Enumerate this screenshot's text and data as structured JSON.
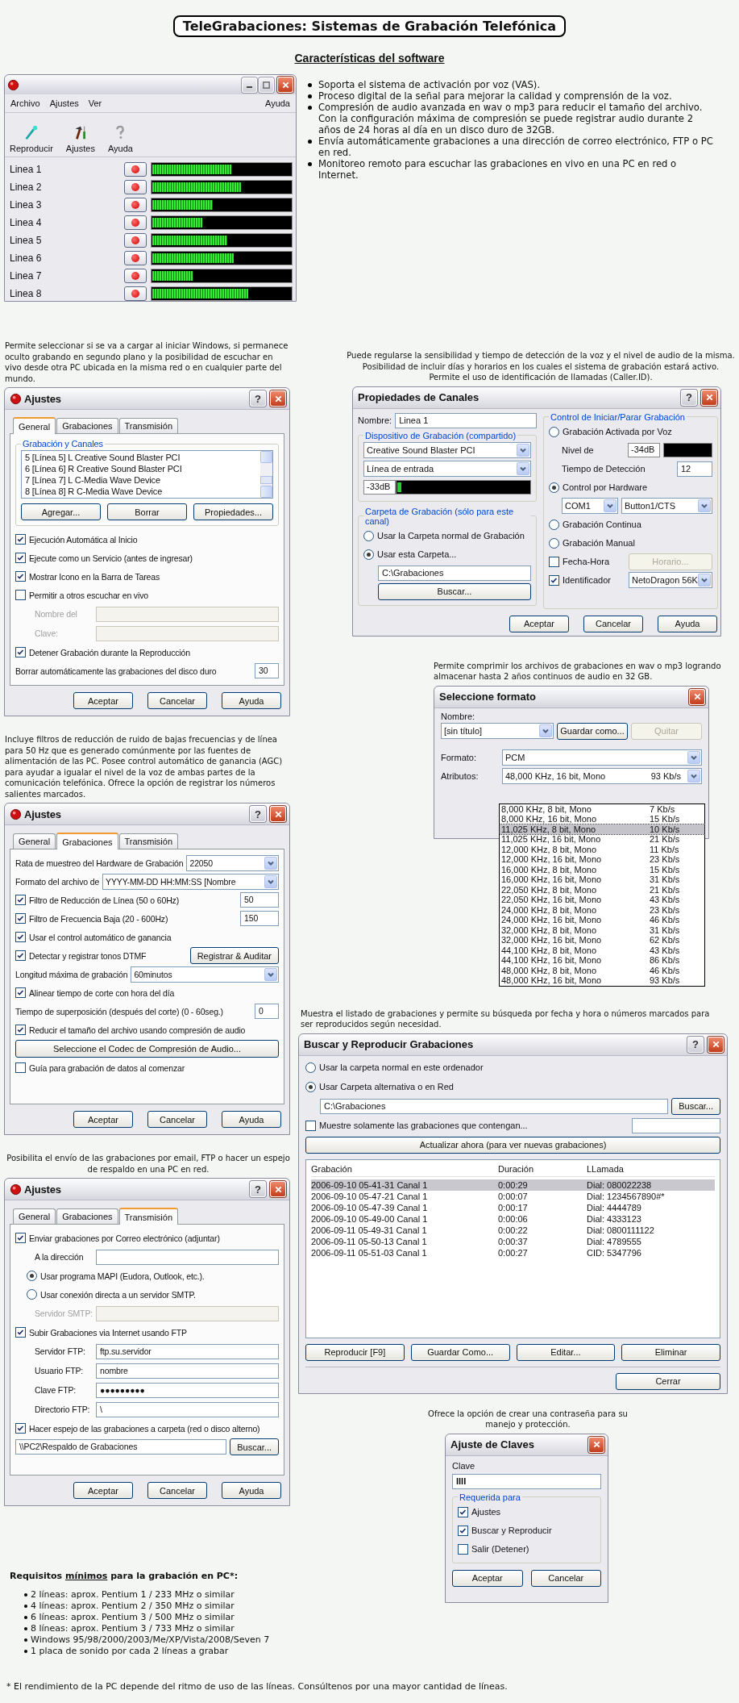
{
  "title": "TeleGrabaciones: Sistemas de Grabación Telefónica",
  "subtitle": "Características del software",
  "main_window": {
    "menu": [
      "Archivo",
      "Ajustes",
      "Ver",
      "Ayuda"
    ],
    "toolbar": [
      {
        "label": "Reproducir",
        "kind": "play"
      },
      {
        "label": "Ajustes",
        "kind": "tools"
      },
      {
        "label": "Ayuda",
        "kind": "help"
      }
    ],
    "lines": [
      {
        "name": "Linea 1",
        "level": 0.57
      },
      {
        "name": "Linea 2",
        "level": 0.64
      },
      {
        "name": "Linea 3",
        "level": 0.44
      },
      {
        "name": "Linea 4",
        "level": 0.36
      },
      {
        "name": "Linea 5",
        "level": 0.54
      },
      {
        "name": "Linea 6",
        "level": 0.59
      },
      {
        "name": "Linea 7",
        "level": 0.29
      },
      {
        "name": "Linea 8",
        "level": 0.69
      }
    ]
  },
  "features": [
    "Soporta el sistema de activación por voz (VAS).",
    "Proceso digital de la señal para mejorar la calidad y comprensión de la voz.",
    "Compresión de audio avanzada en wav o mp3 para reducir el tamaño del archivo. Con la configuración máxima de compresión se puede registrar audio durante 2 años de 24 horas al día en un disco duro de 32GB.",
    "Envía automáticamente grabaciones a una dirección de correo electrónico, FTP o PC en red.",
    "Monitoreo remoto para escuchar las grabaciones en vivo en una PC en red o Internet."
  ],
  "settings_windows": [
    {
      "caption": "Permite seleccionar si se va a cargar al iniciar Windows, si permanece oculto grabando en segundo plano y la posibilidad de escuchar en vivo desde otra PC ubicada en la misma red o en cualquier parte del mundo.",
      "title": "Ajustes",
      "help_button": "?",
      "tabs": [
        {
          "label": "General",
          "selected": true
        },
        {
          "label": "Grabaciones",
          "selected": false
        },
        {
          "label": "Transmisión",
          "selected": false
        }
      ],
      "group": {
        "label": "Grabación y Canales",
        "items": [
          "5 [Línea 5] L Creative Sound Blaster PCI",
          "6 [Línea 6] R Creative Sound Blaster PCI",
          "7 [Línea 7] L C-Media Wave Device",
          "8 [Línea 8] R C-Media Wave Device"
        ],
        "buttons": [
          "Agregar...",
          "Borrar",
          "Propiedades..."
        ]
      },
      "rows": [
        {
          "kind": "check",
          "label": "Ejecución Automática al Inicio",
          "checked": true
        },
        {
          "kind": "check",
          "label": "Ejecute como un Servicio (antes de ingresar)",
          "checked": true
        },
        {
          "kind": "check",
          "label": "Mostrar Icono en la Barra de Tareas",
          "checked": true
        },
        {
          "kind": "check",
          "label": "Permitir a otros escuchar en vivo",
          "checked": false
        },
        {
          "kind": "field",
          "label": "Nombre del",
          "disabled": true
        },
        {
          "kind": "field",
          "label": "Clave:",
          "disabled": true
        },
        {
          "kind": "check",
          "label": "Detener Grabación durante la Reproducción",
          "checked": true
        },
        {
          "kind": "input",
          "label": "Borrar automáticamente las grabaciones del disco duro",
          "value": "30"
        }
      ],
      "buttons": [
        "Aceptar",
        "Cancelar",
        "Ayuda"
      ]
    },
    {
      "caption": "Incluye filtros de reducción de ruido de bajas frecuencias y de línea para 50 Hz que es generado comúnmente por las fuentes de alimentación de las PC. Posee control automático de ganancia (AGC) para ayudar a igualar el nivel de la voz de ambas partes de la comunicación telefónica. Ofrece la opción de registrar los números salientes marcados.",
      "title": "Ajustes",
      "help_button": "?",
      "tabs": [
        {
          "label": "General",
          "selected": false
        },
        {
          "label": "Grabaciones",
          "selected": true
        },
        {
          "label": "Transmisión",
          "selected": false
        }
      ],
      "rows": [
        {
          "kind": "select",
          "label": "Rata de muestreo del Hardware de Grabación",
          "value": "22050"
        },
        {
          "kind": "select",
          "label": "Formato del archivo de",
          "value": "YYYY-MM-DD HH:MM:SS [Nombre"
        },
        {
          "kind": "check-input",
          "label": "Filtro de Reducción de Línea (50 o 60Hz)",
          "checked": true,
          "value": "50"
        },
        {
          "kind": "check-input",
          "label": "Filtro de Frecuencia Baja (20 - 600Hz)",
          "checked": true,
          "value": "150"
        },
        {
          "kind": "check",
          "label": "Usar el control automático de ganancia",
          "checked": true
        },
        {
          "kind": "check-button",
          "label": "Detectar y registrar tonos DTMF",
          "checked": true,
          "button": "Registrar & Auditar"
        },
        {
          "kind": "select",
          "label": "Longitud máxima de grabación",
          "value": "60minutos"
        },
        {
          "kind": "check",
          "label": "Alinear tiempo de corte con hora del día",
          "checked": true
        },
        {
          "kind": "input",
          "label": "Tiempo de superposición (después del corte) (0 - 60seg.)",
          "value": "0"
        },
        {
          "kind": "check",
          "label": "Reducir el tamaño del archivo usando compresión de audio",
          "checked": true
        },
        {
          "kind": "button",
          "label": "Seleccione el Codec de Compresión de Audio..."
        },
        {
          "kind": "check",
          "label": "Guía para grabación de datos al comenzar",
          "checked": false
        }
      ],
      "buttons": [
        "Aceptar",
        "Cancelar",
        "Ayuda"
      ]
    },
    {
      "caption": "Posibilita el envío de las grabaciones por email, FTP o hacer un espejo de respaldo en una PC en red.",
      "title": "Ajustes",
      "help_button": "?",
      "tabs": [
        {
          "label": "General",
          "selected": false
        },
        {
          "label": "Grabaciones",
          "selected": false
        },
        {
          "label": "Transmisión",
          "selected": true
        }
      ],
      "rows": [
        {
          "kind": "check",
          "label": "Enviar grabaciones por Correo electrónico (adjuntar)",
          "checked": true
        },
        {
          "kind": "field",
          "label": "A la dirección",
          "disabled": false
        },
        {
          "kind": "radio",
          "label": "Usar programa MAPI (Eudora, Outlook, etc.).",
          "selected": true
        },
        {
          "kind": "radio",
          "label": "Usar conexión directa a un servidor SMTP.",
          "selected": false
        },
        {
          "kind": "field",
          "label": "Servidor SMTP:",
          "disabled": true
        },
        {
          "kind": "check",
          "label": "Subir Grabaciones via Internet usando FTP",
          "checked": true
        },
        {
          "kind": "field",
          "label": "Servidor FTP:",
          "value": "ftp.su.servidor",
          "disabled": false
        },
        {
          "kind": "field",
          "label": "Usuario FTP:",
          "value": "nombre",
          "disabled": false
        },
        {
          "kind": "field",
          "label": "Clave FTP:",
          "value": "●●●●●●●●●",
          "disabled": false
        },
        {
          "kind": "field",
          "label": "Directorio FTP:",
          "value": "\\",
          "disabled": false
        },
        {
          "kind": "check",
          "label": "Hacer espejo de las grabaciones a carpeta (red o disco alterno)",
          "checked": true
        },
        {
          "kind": "path",
          "value": "\\\\PC2\\Respaldo de Grabaciones",
          "button": "Buscar..."
        }
      ],
      "buttons": [
        "Aceptar",
        "Cancelar",
        "Ayuda"
      ]
    }
  ],
  "channel_properties": {
    "caption": "Puede regularse la sensibilidad y tiempo de detección de la voz y el nivel de audio de la misma. Posibilidad de incluir días y horarios en los cuales el sistema de grabación estará activo. Permite el uso de identificación de llamadas (Caller.ID).",
    "title": "Propiedades de Canales",
    "help_button": "?",
    "name_label": "Nombre:",
    "name": "Linea 1",
    "device": {
      "label": "Dispositivo de Grabación (compartido)",
      "inputs": [
        "Creative Sound Blaster PCI",
        "Línea de entrada"
      ],
      "reading": "-33dB",
      "level": 0.03
    },
    "folder": {
      "label": "Carpeta de Grabación (sólo para este canal)",
      "options": [
        {
          "label": "Usar la Carpeta normal de Grabación",
          "selected": false
        },
        {
          "label": "Usar esta Carpeta...",
          "selected": true
        }
      ],
      "path": "C:\\Grabaciones",
      "button": "Buscar..."
    },
    "control": {
      "label": "Control de Iniciar/Parar Grabación",
      "voice": {
        "label": "Grabación Activada por Voz",
        "selected": false
      },
      "level_label": "Nivel de",
      "reading": "-34dB",
      "time_label": "Tiempo de Detección",
      "time": "12",
      "hardware": {
        "label": "Control por Hardware",
        "selected": true
      },
      "port": "COM1",
      "signal": "Button1/CTS",
      "continuous": {
        "label": "Grabación Continua",
        "selected": false
      },
      "manual": {
        "label": "Grabación Manual",
        "selected": false
      },
      "datetime": {
        "label": "Fecha-Hora",
        "checked": false
      },
      "schedule_button": {
        "label": "Horario...",
        "disabled": true
      },
      "caller_id": {
        "label": "Identificador",
        "checked": true
      },
      "modem": "NetoDragon 56K"
    },
    "buttons": [
      "Aceptar",
      "Cancelar",
      "Ayuda"
    ]
  },
  "format": {
    "caption": "Permite comprimir los archivos de grabaciones en wav o mp3 logrando almacenar hasta 2 años continuos de audio en 32 GB.",
    "title": "Seleccione formato",
    "name_label": "Nombre:",
    "name": "[sin título]",
    "buttons": [
      {
        "label": "Guardar como...",
        "disabled": false
      },
      {
        "label": "Quitar",
        "disabled": true
      }
    ],
    "format_label": "Formato:",
    "format": "PCM",
    "attr_label": "Atributos:",
    "attr": {
      "format": "48,000 KHz, 16 bit, Mono",
      "rate": "93 Kb/s"
    },
    "options": [
      {
        "format": "8,000 KHz, 8 bit, Mono",
        "rate": "7 Kb/s",
        "selected": false
      },
      {
        "format": "8,000 KHz, 16 bit, Mono",
        "rate": "15 Kb/s",
        "selected": false
      },
      {
        "format": "11,025 KHz, 8 bit, Mono",
        "rate": "10 Kb/s",
        "selected": true
      },
      {
        "format": "11,025 KHz, 16 bit, Mono",
        "rate": "21 Kb/s",
        "selected": false
      },
      {
        "format": "12,000 KHz, 8 bit, Mono",
        "rate": "11 Kb/s",
        "selected": false
      },
      {
        "format": "12,000 KHz, 16 bit, Mono",
        "rate": "23 Kb/s",
        "selected": false
      },
      {
        "format": "16,000 KHz, 8 bit, Mono",
        "rate": "15 Kb/s",
        "selected": false
      },
      {
        "format": "16,000 KHz, 16 bit, Mono",
        "rate": "31 Kb/s",
        "selected": false
      },
      {
        "format": "22,050 KHz, 8 bit, Mono",
        "rate": "21 Kb/s",
        "selected": false
      },
      {
        "format": "22,050 KHz, 16 bit, Mono",
        "rate": "43 Kb/s",
        "selected": false
      },
      {
        "format": "24,000 KHz, 8 bit, Mono",
        "rate": "23 Kb/s",
        "selected": false
      },
      {
        "format": "24,000 KHz, 16 bit, Mono",
        "rate": "46 Kb/s",
        "selected": false
      },
      {
        "format": "32,000 KHz, 8 bit, Mono",
        "rate": "31 Kb/s",
        "selected": false
      },
      {
        "format": "32,000 KHz, 16 bit, Mono",
        "rate": "62 Kb/s",
        "selected": false
      },
      {
        "format": "44,100 KHz, 8 bit, Mono",
        "rate": "43 Kb/s",
        "selected": false
      },
      {
        "format": "44,100 KHz, 16 bit, Mono",
        "rate": "86 Kb/s",
        "selected": false
      },
      {
        "format": "48,000 KHz, 8 bit, Mono",
        "rate": "46 Kb/s",
        "selected": false
      },
      {
        "format": "48,000 KHz, 16 bit, Mono",
        "rate": "93 Kb/s",
        "selected": false
      }
    ]
  },
  "search": {
    "caption": "Muestra el listado de grabaciones y permite su búsqueda por fecha y hora o números marcados para ser reproducidos según necesidad.",
    "title": "Buscar y Reproducir Grabaciones",
    "help_button": "?",
    "options": [
      {
        "label": "Usar la carpeta normal en este ordenador",
        "selected": false
      },
      {
        "label": "Usar Carpeta alternativa o en Red",
        "selected": true
      }
    ],
    "path": "C:\\Grabaciones",
    "browse": "Buscar...",
    "filter": {
      "label": "Muestre solamente las grabaciones que contengan...",
      "checked": false
    },
    "refresh": "Actualizar ahora (para ver nuevas grabaciones)",
    "columns": [
      "Grabación",
      "Duración",
      "LLamada"
    ],
    "rows": [
      {
        "cells": [
          "2006-09-10 05-41-31 Canal 1",
          "0:00:29",
          "Dial: 080022238"
        ],
        "selected": true
      },
      {
        "cells": [
          "2006-09-10 05-47-21 Canal 1",
          "0:00:07",
          "Dial: 1234567890#*"
        ],
        "selected": false
      },
      {
        "cells": [
          "2006-09-10 05-47-39 Canal 1",
          "0:00:17",
          "Dial: 4444789"
        ],
        "selected": false
      },
      {
        "cells": [
          "2006-09-10 05-49-00 Canal 1",
          "0:00:06",
          "Dial: 4333123"
        ],
        "selected": false
      },
      {
        "cells": [
          "2006-09-11 05-49-31 Canal 1",
          "0:00:22",
          "Dial: 0800111122"
        ],
        "selected": false
      },
      {
        "cells": [
          "2006-09-11 05-50-13 Canal 1",
          "0:00:37",
          "Dial: 4789555"
        ],
        "selected": false
      },
      {
        "cells": [
          "2006-09-11 05-51-03 Canal 1",
          "0:00:27",
          "CID: 5347796"
        ],
        "selected": false
      }
    ],
    "actions": [
      "Reproducir [F9]",
      "Guardar Como...",
      "Editar...",
      "Eliminar"
    ],
    "close": "Cerrar"
  },
  "password": {
    "caption": "Ofrece la opción de crear una contraseña para su manejo y protección.",
    "title": "Ajuste de Claves",
    "label": "Clave",
    "value": "IIII",
    "group": "Requerida para",
    "checks": [
      {
        "label": "Ajustes",
        "checked": true
      },
      {
        "label": "Buscar y Reproducir",
        "checked": true
      },
      {
        "label": "Salir (Detener)",
        "checked": false
      }
    ],
    "buttons": [
      "Aceptar",
      "Cancelar"
    ]
  },
  "requirements": {
    "heading_before": "Requisitos",
    "heading_emphasis": "mínimos",
    "heading_after": "para la grabación en PC*:",
    "items": [
      "2 líneas: aprox. Pentium 1 / 233 MHz o similar",
      "4 líneas: aprox. Pentium 2 / 350 MHz o similar",
      "6 líneas: aprox. Pentium 3 / 500 MHz o similar",
      "8 líneas: aprox. Pentium 3 / 733 MHz o similar",
      "Windows 95/98/2000/2003/Me/XP/Vista/2008/Seven 7",
      "1 placa de sonido por cada 2 líneas a grabar"
    ]
  },
  "footnote": "* El rendimiento de la PC depende del ritmo de uso de las líneas. Consúltenos por una mayor cantidad de líneas."
}
